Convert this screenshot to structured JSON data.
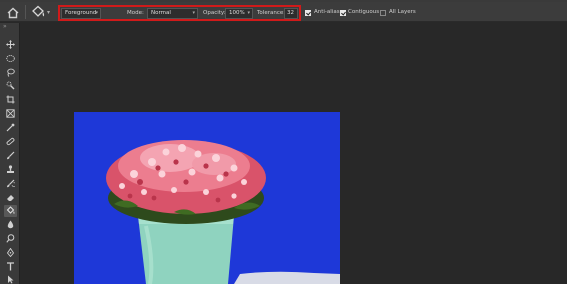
{
  "options": {
    "tool_preset_icon": "paint-bucket-icon",
    "fill_source": "Foreground",
    "mode_label": "Mode:",
    "mode_value": "Normal",
    "opacity_label": "Opacity:",
    "opacity_value": "100%",
    "tolerance_label": "Tolerance:",
    "tolerance_value": "32",
    "anti_alias": {
      "label": "Anti-alias",
      "checked": true
    },
    "contiguous": {
      "label": "Contiguous",
      "checked": true
    },
    "all_layers": {
      "label": "All Layers",
      "checked": false
    },
    "highlight_color": "#d11a1a"
  },
  "toolbar": {
    "collapse_glyph": "»",
    "tools": [
      "move-tool-icon",
      "marquee-tool-icon",
      "lasso-tool-icon",
      "quick-selection-tool-icon",
      "crop-tool-icon",
      "frame-tool-icon",
      "eyedropper-tool-icon",
      "healing-brush-tool-icon",
      "brush-tool-icon",
      "clone-stamp-tool-icon",
      "history-brush-tool-icon",
      "eraser-tool-icon",
      "paint-bucket-tool-icon",
      "blur-tool-icon",
      "dodge-tool-icon",
      "pen-tool-icon",
      "type-tool-icon",
      "path-selection-tool-icon"
    ],
    "active_tool": "paint-bucket-tool-icon"
  },
  "canvas": {
    "background_color": "#1e38d8",
    "image": "pink-flowers-in-mint-pot"
  }
}
